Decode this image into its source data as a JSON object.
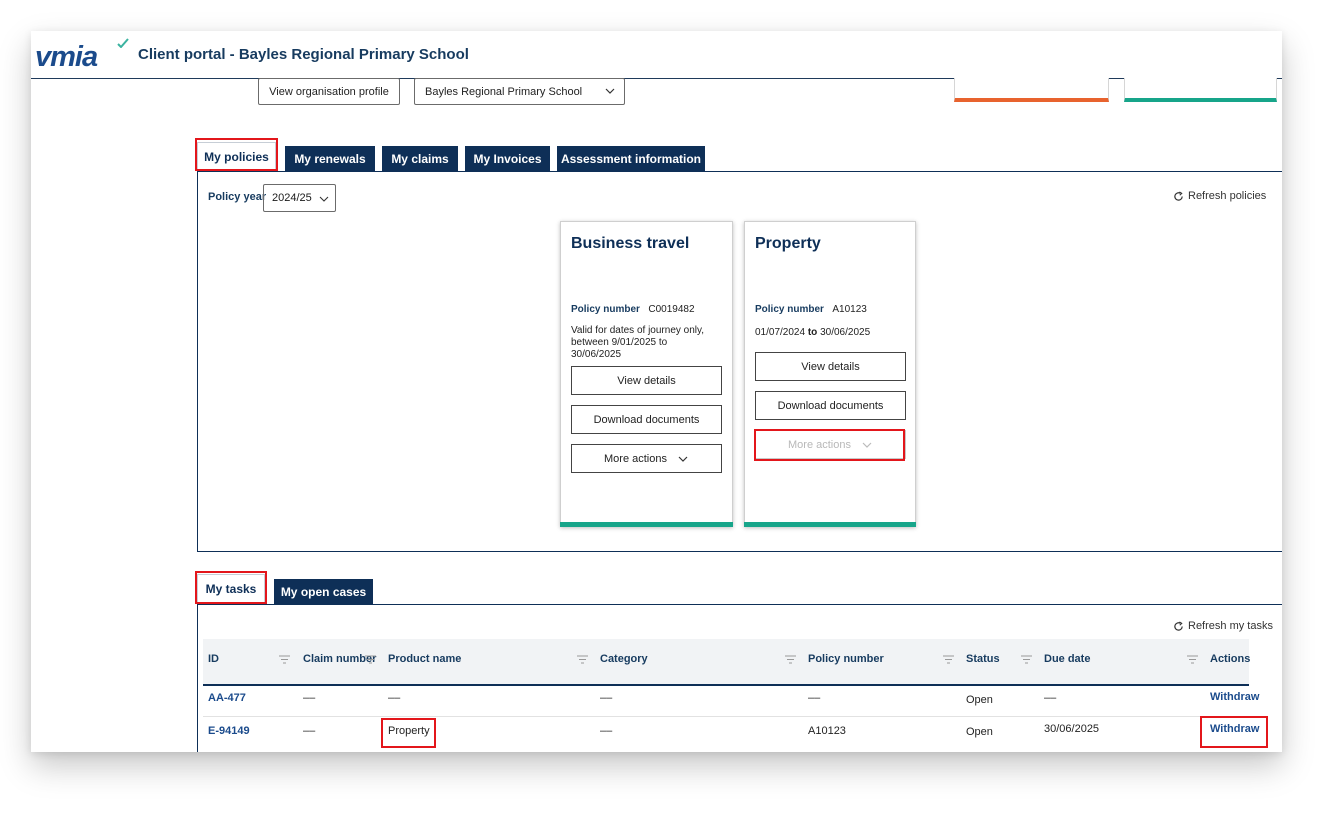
{
  "header": {
    "logo_text": "vmia",
    "portal_title": "Client portal - Bayles Regional Primary School"
  },
  "org": {
    "view_profile_label": "View organisation profile",
    "selected_org": "Bayles Regional Primary School"
  },
  "top_cards": [
    {
      "accent": "#e8632e"
    },
    {
      "accent": "#17a58a"
    }
  ],
  "policy_tabs": [
    {
      "label": "My policies",
      "active": true
    },
    {
      "label": "My renewals",
      "active": false
    },
    {
      "label": "My claims",
      "active": false
    },
    {
      "label": "My Invoices",
      "active": false
    },
    {
      "label": "Assessment information",
      "active": false
    }
  ],
  "policies": {
    "year_label": "Policy year",
    "year_value": "2024/25",
    "refresh_label": "Refresh policies",
    "cards": [
      {
        "title": "Business travel",
        "policy_number_label": "Policy number",
        "policy_number": "C0019482",
        "validity_line1": "Valid for dates of journey only,",
        "validity_line2": "between 9/01/2025 to",
        "validity_line3": "30/06/2025",
        "view_details": "View details",
        "download_documents": "Download documents",
        "more_actions": "More actions",
        "more_actions_enabled": true
      },
      {
        "title": "Property",
        "policy_number_label": "Policy number",
        "policy_number": "A10123",
        "date_from": "01/07/2024",
        "date_to_word": "to",
        "date_to": "30/06/2025",
        "view_details": "View details",
        "download_documents": "Download documents",
        "more_actions": "More actions",
        "more_actions_enabled": false
      }
    ]
  },
  "task_tabs": [
    {
      "label": "My tasks",
      "active": true
    },
    {
      "label": "My open cases",
      "active": false
    }
  ],
  "tasks": {
    "refresh_label": "Refresh my tasks",
    "columns": [
      "ID",
      "Claim number",
      "Product name",
      "Category",
      "Policy number",
      "Status",
      "Due date",
      "Actions"
    ],
    "rows": [
      {
        "id": "AA-477",
        "claim_number": "––",
        "product_name": "––",
        "category": "––",
        "policy_number": "––",
        "status": "Open",
        "due_date": "––",
        "action": "Withdraw"
      },
      {
        "id": "E-94149",
        "claim_number": "––",
        "product_name": "Property",
        "category": "––",
        "policy_number": "A10123",
        "status": "Open",
        "due_date": "30/06/2025",
        "action": "Withdraw"
      }
    ]
  },
  "colors": {
    "navy": "#0e2f57",
    "highlight_red": "#e3161b",
    "teal_stripe": "#17a58a",
    "orange_stripe": "#e8632e"
  }
}
